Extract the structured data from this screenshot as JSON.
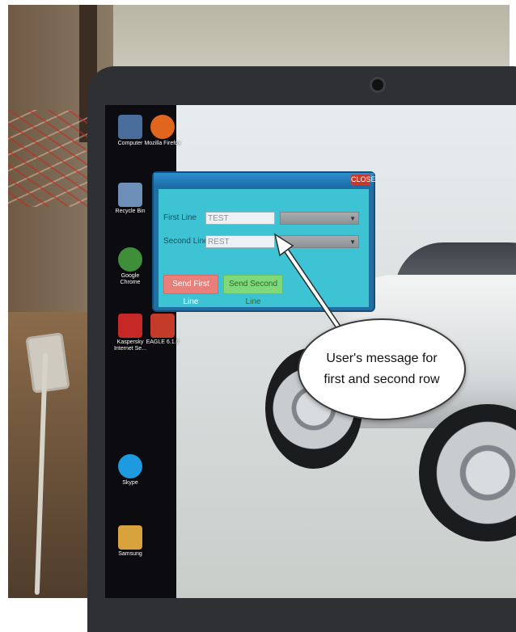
{
  "app_window": {
    "close_label": "CLOSE",
    "first_line_label": "First Line",
    "first_line_value": "TEST",
    "second_line_label": "Second Line",
    "second_line_value": "REST",
    "send_first_label": "Send First Line",
    "send_second_label": "Send Second Line"
  },
  "annotation": {
    "line1": "User's message for",
    "line2": "first and second row"
  },
  "desktop_icons": [
    {
      "label": "Computer",
      "color": "#4a6e9c"
    },
    {
      "label": "Mozilla Firefox",
      "color": "#e0661e"
    },
    {
      "label": "Recycle Bin",
      "color": "#6d8fb8"
    },
    {
      "label": "Google Chrome",
      "color": "#3f8f3a"
    },
    {
      "label": "Kaspersky Internet Se...",
      "color": "#c62828"
    },
    {
      "label": "EAGLE 6.1.0",
      "color": "#c43b2a"
    },
    {
      "label": "Skype",
      "color": "#1e9be0"
    },
    {
      "label": "Samsung",
      "color": "#d8a23c"
    }
  ],
  "colors": {
    "app_bg": "#3ec3d4",
    "red_button": "#e97f7a",
    "green_button": "#7fd97a"
  }
}
